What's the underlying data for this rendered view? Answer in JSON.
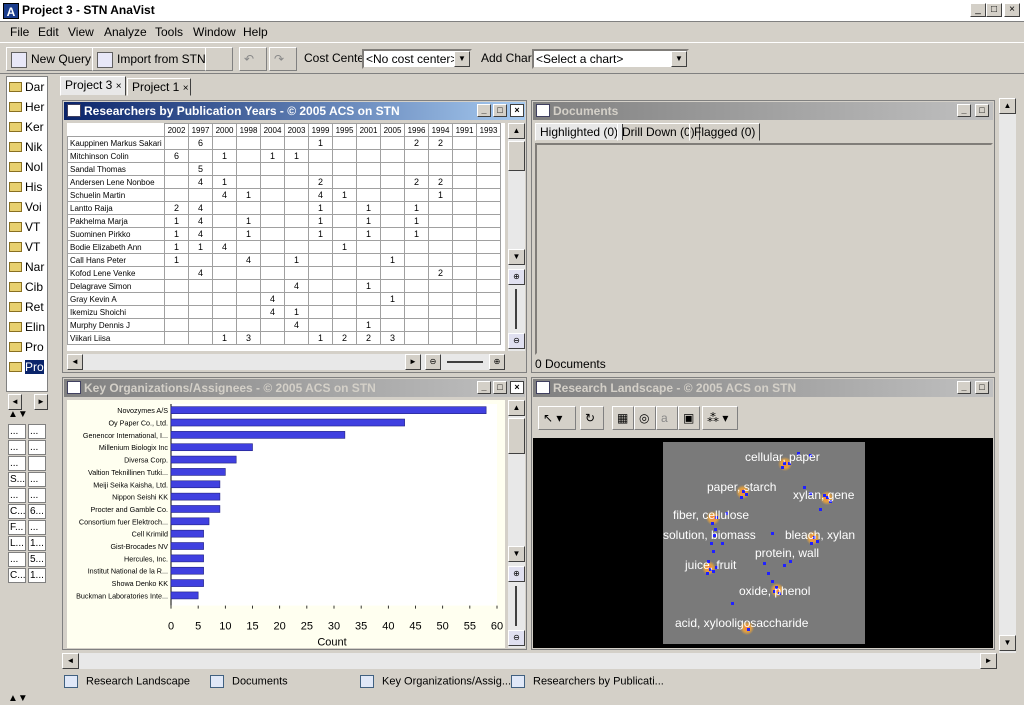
{
  "window": {
    "title": "Project 3 - STN AnaVist",
    "app_icon_letter": "A",
    "controls": [
      "_",
      "□",
      "×"
    ]
  },
  "menu": [
    "File",
    "Edit",
    "View",
    "Analyze",
    "Tools",
    "Window",
    "Help"
  ],
  "toolbar": {
    "new_query": "New Query",
    "import_from_stn": "Import from STN",
    "cost_center_label": "Cost Center:",
    "cost_center_value": "<No cost center>",
    "add_chart_label": "Add Chart:",
    "add_chart_value": "<Select a chart>"
  },
  "sidebar": {
    "items": [
      "Dar",
      "Her",
      "Ker",
      "Nik",
      "Nol",
      "His",
      "Voi",
      "VT",
      "VT",
      "Nar",
      "Cib",
      "Ret",
      "Elin",
      "Pro",
      "Pro"
    ],
    "selected_index": 14
  },
  "mini_grid": [
    [
      "...",
      "..."
    ],
    [
      "...",
      "..."
    ],
    [
      "...",
      ""
    ],
    [
      "S...",
      "..."
    ],
    [
      "...",
      "..."
    ],
    [
      "C...",
      "6..."
    ],
    [
      "F...",
      "..."
    ],
    [
      "L...",
      "1..."
    ],
    [
      "...",
      "5..."
    ],
    [
      "C...",
      "1..."
    ]
  ],
  "tabs": [
    {
      "label": "Project 3",
      "close": "×",
      "active": true
    },
    {
      "label": "Project 1",
      "close": "×",
      "active": false
    }
  ],
  "researchers": {
    "title": "Researchers by Publication Years - © 2005 ACS on STN",
    "years": [
      "2002",
      "1997",
      "2000",
      "1998",
      "2004",
      "2003",
      "1999",
      "1995",
      "2001",
      "2005",
      "1996",
      "1994",
      "1991",
      "1993"
    ],
    "rows": [
      {
        "name": "Kauppinen Markus Sakari",
        "cells": [
          "",
          "6",
          "",
          "",
          "",
          "",
          "1",
          "",
          "",
          "",
          "2",
          "2",
          "",
          ""
        ]
      },
      {
        "name": "Mitchinson Colin",
        "cells": [
          "6",
          "",
          "1",
          "",
          "1",
          "1",
          "",
          "",
          "",
          "",
          "",
          "",
          "",
          ""
        ]
      },
      {
        "name": "Sandal Thomas",
        "cells": [
          "",
          "5",
          "",
          "",
          "",
          "",
          "",
          "",
          "",
          "",
          "",
          "",
          "",
          ""
        ]
      },
      {
        "name": "Andersen Lene Nonboe",
        "cells": [
          "",
          "4",
          "1",
          "",
          "",
          "",
          "2",
          "",
          "",
          "",
          "2",
          "2",
          "",
          ""
        ]
      },
      {
        "name": "Schuelin Martin",
        "cells": [
          "",
          "",
          "4",
          "1",
          "",
          "",
          "4",
          "1",
          "",
          "",
          "",
          "1",
          "",
          ""
        ]
      },
      {
        "name": "Lantto Raija",
        "cells": [
          "2",
          "4",
          "",
          "",
          "",
          "",
          "1",
          "",
          "1",
          "",
          "1",
          "",
          "",
          ""
        ]
      },
      {
        "name": "Pakhelma Marja",
        "cells": [
          "1",
          "4",
          "",
          "1",
          "",
          "",
          "1",
          "",
          "1",
          "",
          "1",
          "",
          "",
          ""
        ]
      },
      {
        "name": "Suominen Pirkko",
        "cells": [
          "1",
          "4",
          "",
          "1",
          "",
          "",
          "1",
          "",
          "1",
          "",
          "1",
          "",
          "",
          ""
        ]
      },
      {
        "name": "Bodie Elizabeth Ann",
        "cells": [
          "1",
          "1",
          "4",
          "",
          "",
          "",
          "",
          "1",
          "",
          "",
          "",
          "",
          "",
          ""
        ]
      },
      {
        "name": "Call Hans Peter",
        "cells": [
          "1",
          "",
          "",
          "4",
          "",
          "1",
          "",
          "",
          "",
          "1",
          "",
          "",
          "",
          ""
        ]
      },
      {
        "name": "Kofod Lene Venke",
        "cells": [
          "",
          "4",
          "",
          "",
          "",
          "",
          "",
          "",
          "",
          "",
          "",
          "2",
          "",
          ""
        ]
      },
      {
        "name": "Delagrave Simon",
        "cells": [
          "",
          "",
          "",
          "",
          "",
          "4",
          "",
          "",
          "1",
          "",
          "",
          "",
          "",
          ""
        ]
      },
      {
        "name": "Gray Kevin A",
        "cells": [
          "",
          "",
          "",
          "",
          "4",
          "",
          "",
          "",
          "",
          "1",
          "",
          "",
          "",
          ""
        ]
      },
      {
        "name": "Ikemizu Shoichi",
        "cells": [
          "",
          "",
          "",
          "",
          "4",
          "1",
          "",
          "",
          "",
          "",
          "",
          "",
          "",
          ""
        ]
      },
      {
        "name": "Murphy Dennis J",
        "cells": [
          "",
          "",
          "",
          "",
          "",
          "4",
          "",
          "",
          "1",
          "",
          "",
          "",
          "",
          ""
        ]
      },
      {
        "name": "Viikari Liisa",
        "cells": [
          "",
          "",
          "1",
          "3",
          "",
          "",
          "1",
          "2",
          "2",
          "3",
          "",
          "",
          "",
          ""
        ]
      }
    ]
  },
  "documents": {
    "title": "Documents",
    "tabs": [
      "Highlighted (0)",
      "Drill Down (0)",
      "Flagged (0)"
    ],
    "status": "0 Documents"
  },
  "organizations": {
    "title": "Key Organizations/Assignees - © 2005 ACS on STN"
  },
  "chart_data": {
    "type": "bar",
    "orientation": "horizontal",
    "categories": [
      "Novozymes A/S",
      "Oy Paper Co., Ltd.",
      "Genencor International, I...",
      "Millenium Biologix Inc",
      "Diversa Corp.",
      "Valtion Teknillinen Tutki...",
      "Meiji Seika Kaisha, Ltd.",
      "Nippon Seishi KK",
      "Procter and Gamble Co.",
      "Consortium fuer Elektroch...",
      "Cell Krimild",
      "Gist-Brocades NV",
      "Hercules, Inc.",
      "Institut National de la R...",
      "Showa Denko KK",
      "Buckman Laboratories Inte..."
    ],
    "values": [
      58,
      43,
      32,
      15,
      12,
      10,
      9,
      9,
      9,
      7,
      6,
      6,
      6,
      6,
      6,
      5
    ],
    "xlabel": "Count",
    "xticks": [
      0,
      5,
      10,
      15,
      20,
      25,
      30,
      35,
      40,
      45,
      50,
      55,
      60
    ],
    "xlim": [
      0,
      60
    ],
    "bar_color": "#4040e0"
  },
  "landscape": {
    "title": "Research Landscape - © 2005 ACS on STN",
    "labels": [
      "cellular, paper",
      "paper, starch",
      "xylan, gene",
      "fiber, cellulose",
      "solution, biomass",
      "bleach, xylan",
      "protein, wall",
      "juice, fruit",
      "oxide, phenol",
      "acid, xylooligosaccharide"
    ]
  },
  "bottom_tabs": [
    "Research Landscape",
    "Documents",
    "Key Organizations/Assig...",
    "Researchers by Publicati..."
  ]
}
